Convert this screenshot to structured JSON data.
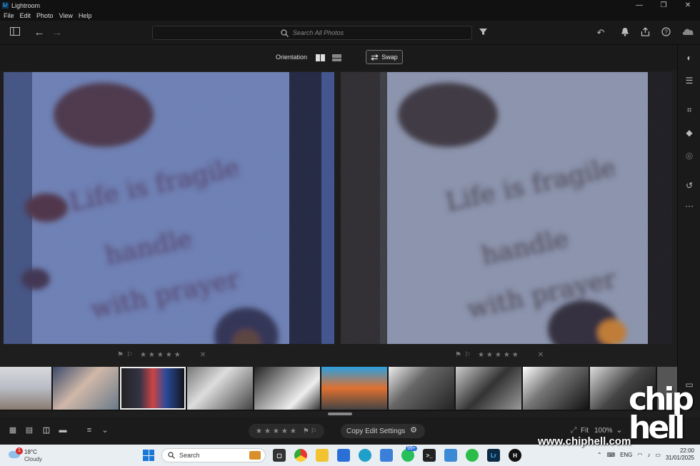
{
  "app": {
    "title": "Lightroom",
    "logo_text": "Lr"
  },
  "window_controls": [
    "—",
    "❐",
    "✕"
  ],
  "menu": [
    "File",
    "Edit",
    "Photo",
    "View",
    "Help"
  ],
  "toolbar": {
    "search_placeholder": "Search All Photos"
  },
  "compare": {
    "orientation_label": "Orientation",
    "swap_label": "Swap"
  },
  "photos": {
    "caption_lines": [
      "Life is fragile",
      "handle",
      "with prayer"
    ]
  },
  "rating_row": {
    "stars": "★★★★★",
    "reject": "✕"
  },
  "bottom_bar": {
    "stars": "★★★★★",
    "copy_edit_label": "Copy Edit Settings",
    "fit_label": "Fit",
    "zoom_value": "100%"
  },
  "taskbar": {
    "weather_temp": "18°C",
    "weather_cond": "Cloudy",
    "weather_badge": "1",
    "search_label": "Search",
    "whatsapp_badge": "99+",
    "language": "ENG",
    "time": "22:00",
    "date": "31/01/2025"
  },
  "watermark": {
    "url": "www.chiphell.com",
    "logo": "chip hell"
  },
  "colors": {
    "accent": "#1a78d6",
    "selected_outline": "#eeeeee",
    "panel_bg": "#1a1a1a"
  }
}
